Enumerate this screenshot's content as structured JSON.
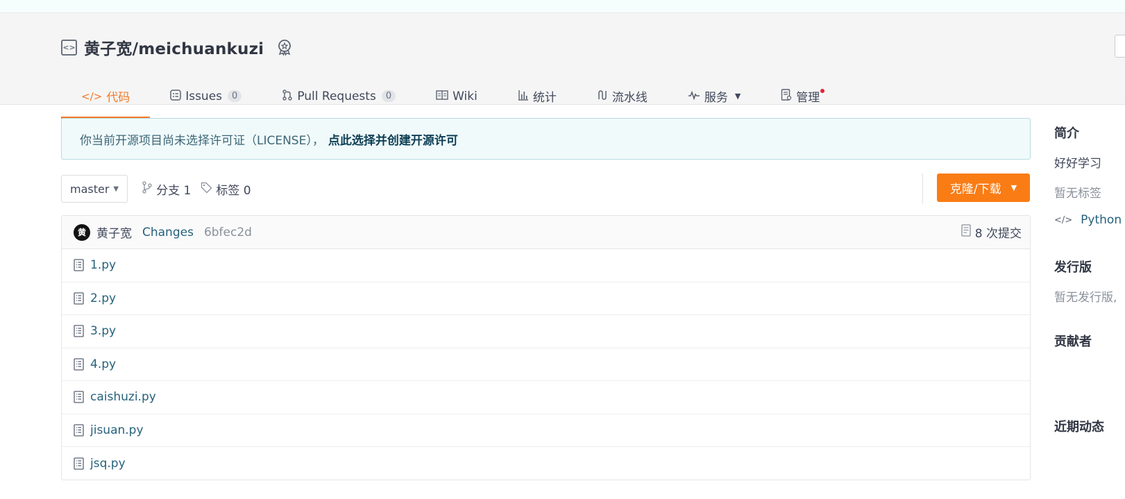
{
  "repo": {
    "owner": "黄子宽",
    "name": "meichuankuzi",
    "full_title": "黄子宽/meichuankuzi"
  },
  "tabs": [
    {
      "label": "代码",
      "icon": "code-icon",
      "active": true
    },
    {
      "label": "Issues",
      "icon": "issues-icon",
      "count": "0"
    },
    {
      "label": "Pull Requests",
      "icon": "pull-request-icon",
      "count": "0"
    },
    {
      "label": "Wiki",
      "icon": "book-icon"
    },
    {
      "label": "统计",
      "icon": "bar-chart-icon"
    },
    {
      "label": "流水线",
      "icon": "pipeline-icon"
    },
    {
      "label": "服务",
      "icon": "pulse-icon",
      "dropdown": true
    },
    {
      "label": "管理",
      "icon": "manage-icon",
      "notification": true
    }
  ],
  "license": {
    "notice": "你当前开源项目尚未选择许可证（LICENSE），",
    "link": "点此选择并创建开源许可"
  },
  "branch": {
    "current": "master",
    "branches_label": "分支 1",
    "tags_label": "标签 0"
  },
  "clone_button": "克隆/下载",
  "commit": {
    "avatar_letter": "黄",
    "author": "黄子宽",
    "message": "Changes",
    "sha": "6bfec2d",
    "count_label": "8 次提交"
  },
  "files": [
    {
      "name": "1.py"
    },
    {
      "name": "2.py"
    },
    {
      "name": "3.py"
    },
    {
      "name": "4.py"
    },
    {
      "name": "caishuzi.py"
    },
    {
      "name": "jisuan.py"
    },
    {
      "name": "jsq.py"
    }
  ],
  "sidebar": {
    "intro_heading": "简介",
    "intro_text": "好好学习",
    "no_tags": "暂无标签",
    "language": "Python",
    "releases_heading": "发行版",
    "releases_text": "暂无发行版,",
    "contributors_heading": "贡献者",
    "activity_heading": "近期动态"
  },
  "colors": {
    "accent": "#f47a28",
    "clone_button": "#fa7c15",
    "link": "#26617b",
    "license_bg": "#f0fafb"
  }
}
